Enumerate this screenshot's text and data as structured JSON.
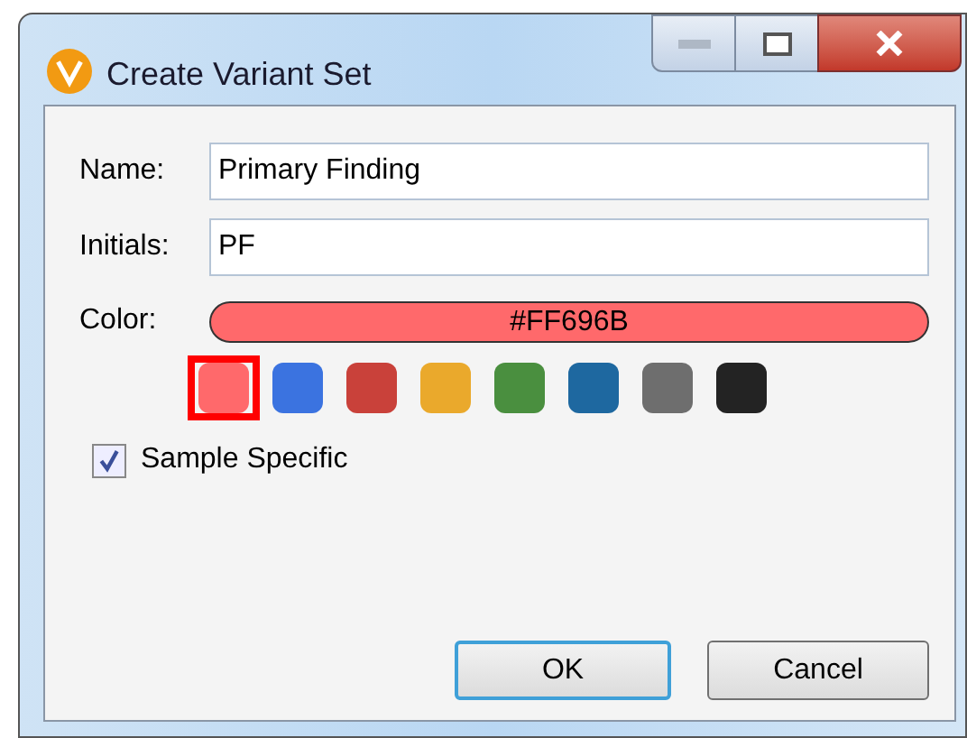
{
  "window": {
    "title": "Create Variant Set"
  },
  "fields": [
    {
      "label": "Name:",
      "value": "Primary Finding"
    },
    {
      "label": "Initials:",
      "value": "PF"
    }
  ],
  "color": {
    "label": "Color:",
    "value": "#FF696B"
  },
  "swatches": [
    {
      "color": "#ff696b",
      "selected": true
    },
    {
      "color": "#3b73e0",
      "selected": false
    },
    {
      "color": "#c9413a",
      "selected": false
    },
    {
      "color": "#eaa92c",
      "selected": false
    },
    {
      "color": "#4a8f3f",
      "selected": false
    },
    {
      "color": "#1e68a0",
      "selected": false
    },
    {
      "color": "#6e6e6e",
      "selected": false
    },
    {
      "color": "#232323",
      "selected": false
    }
  ],
  "sample_specific": {
    "label": "Sample Specific",
    "checked": true
  },
  "buttons": [
    {
      "label": "OK",
      "kind": "default"
    },
    {
      "label": "Cancel",
      "kind": "normal"
    }
  ]
}
